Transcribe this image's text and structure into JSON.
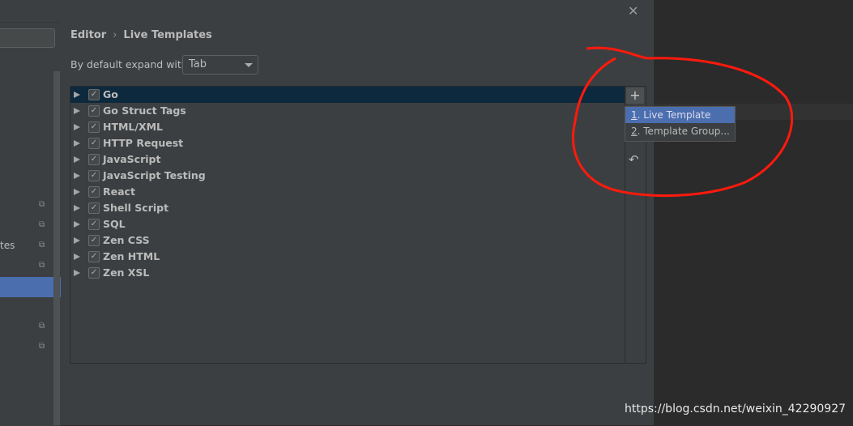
{
  "dialog": {
    "close_icon": "close-icon"
  },
  "sidebar": {
    "partial_text": "tes",
    "selected_index": 0
  },
  "breadcrumb": {
    "parent": "Editor",
    "separator": "›",
    "current": "Live Templates"
  },
  "expand": {
    "label": "By default expand with",
    "value": "Tab"
  },
  "groups": [
    {
      "label": "Go",
      "checked": true,
      "selected": true
    },
    {
      "label": "Go Struct Tags",
      "checked": true
    },
    {
      "label": "HTML/XML",
      "checked": true
    },
    {
      "label": "HTTP Request",
      "checked": true
    },
    {
      "label": "JavaScript",
      "checked": true
    },
    {
      "label": "JavaScript Testing",
      "checked": true
    },
    {
      "label": "React",
      "checked": true
    },
    {
      "label": "Shell Script",
      "checked": true
    },
    {
      "label": "SQL",
      "checked": true
    },
    {
      "label": "Zen CSS",
      "checked": true
    },
    {
      "label": "Zen HTML",
      "checked": true
    },
    {
      "label": "Zen XSL",
      "checked": true
    }
  ],
  "toolbar": {
    "add": "+",
    "revert": "↶"
  },
  "popup": {
    "items": [
      {
        "key": "1",
        "label": ". Live Template"
      },
      {
        "key": "2",
        "label": ". Template Group..."
      }
    ]
  },
  "watermark": "https://blog.csdn.net/weixin_42290927",
  "colors": {
    "annotation": "#ff1a0d",
    "selection": "#4b6eaf",
    "row_selection": "#0d293e"
  }
}
